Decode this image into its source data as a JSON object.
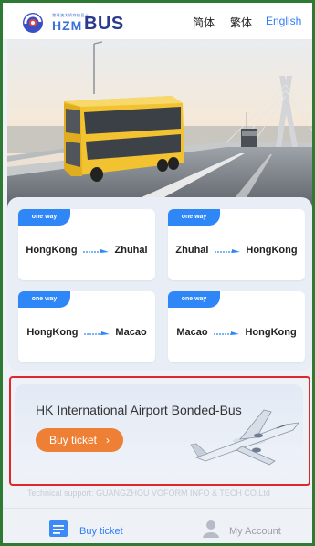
{
  "header": {
    "logo_tiny": "港珠澳大桥穿梭巴士",
    "logo_hzm": "HZM",
    "logo_bus": "BUS",
    "languages": [
      {
        "label": "简体",
        "active": false
      },
      {
        "label": "繁体",
        "active": false
      },
      {
        "label": "English",
        "active": true
      }
    ]
  },
  "routes": [
    {
      "tag": "one way",
      "from": "HongKong",
      "to": "Zhuhai"
    },
    {
      "tag": "one way",
      "from": "Zhuhai",
      "to": "HongKong"
    },
    {
      "tag": "one way",
      "from": "HongKong",
      "to": "Macao"
    },
    {
      "tag": "one way",
      "from": "Macao",
      "to": "HongKong"
    }
  ],
  "airport": {
    "title": "HK International Airport Bonded-Bus",
    "button": "Buy ticket"
  },
  "support": "Technical support:   GUANGZHOU VOFORM INFO & TECH CO.Ltd",
  "tabs": [
    {
      "label": "Buy ticket",
      "active": true
    },
    {
      "label": "My Account",
      "active": false
    }
  ],
  "colors": {
    "accent": "#2f86f6",
    "button": "#ee8036",
    "highlight_border": "#e0262a"
  }
}
